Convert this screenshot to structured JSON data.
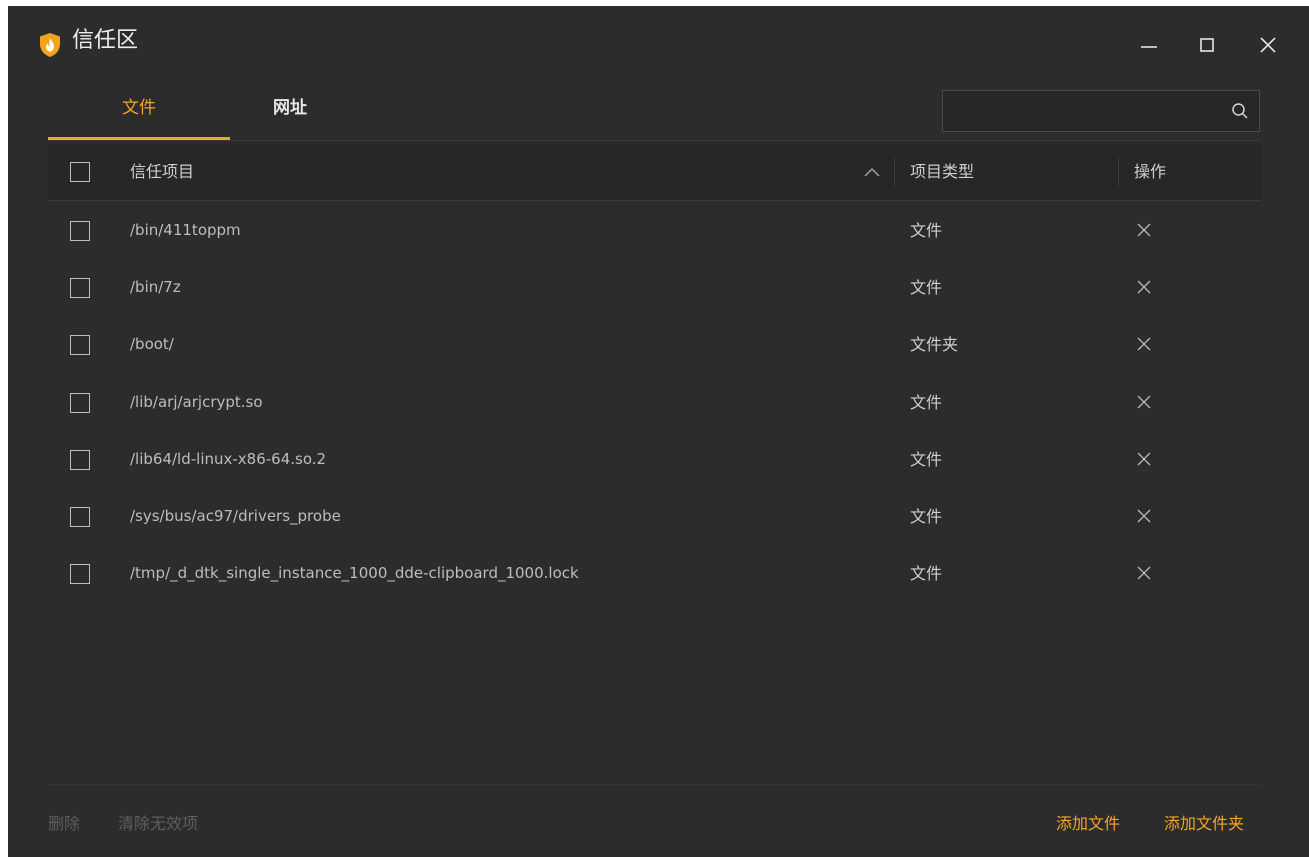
{
  "window": {
    "title": "信任区"
  },
  "tabs": [
    {
      "label": "文件",
      "active": true
    },
    {
      "label": "网址",
      "active": false
    }
  ],
  "search": {
    "placeholder": "",
    "value": ""
  },
  "table": {
    "columns": {
      "item": "信任项目",
      "type": "项目类型",
      "action": "操作"
    },
    "sort": "ascending",
    "rows": [
      {
        "path": "/bin/411toppm",
        "type": "文件"
      },
      {
        "path": "/bin/7z",
        "type": "文件"
      },
      {
        "path": "/boot/",
        "type": "文件夹"
      },
      {
        "path": "/lib/arj/arjcrypt.so",
        "type": "文件"
      },
      {
        "path": "/lib64/ld-linux-x86-64.so.2",
        "type": "文件"
      },
      {
        "path": "/sys/bus/ac97/drivers_probe",
        "type": "文件"
      },
      {
        "path": "/tmp/_d_dtk_single_instance_1000_dde-clipboard_1000.lock",
        "type": "文件"
      }
    ]
  },
  "footer": {
    "delete": "删除",
    "clean_invalid": "清除无效项",
    "add_file": "添加文件",
    "add_folder": "添加文件夹"
  },
  "colors": {
    "accent": "#f5a623",
    "background": "#2c2c2c",
    "header_bg": "#272727",
    "disabled_text": "#5e5e5e"
  },
  "icons": {
    "logo": "shield-flame-icon",
    "minimize": "minimize-icon",
    "maximize": "maximize-icon",
    "close": "close-icon",
    "search": "search-icon",
    "sort": "chevron-up-icon",
    "row_remove": "close-icon"
  }
}
